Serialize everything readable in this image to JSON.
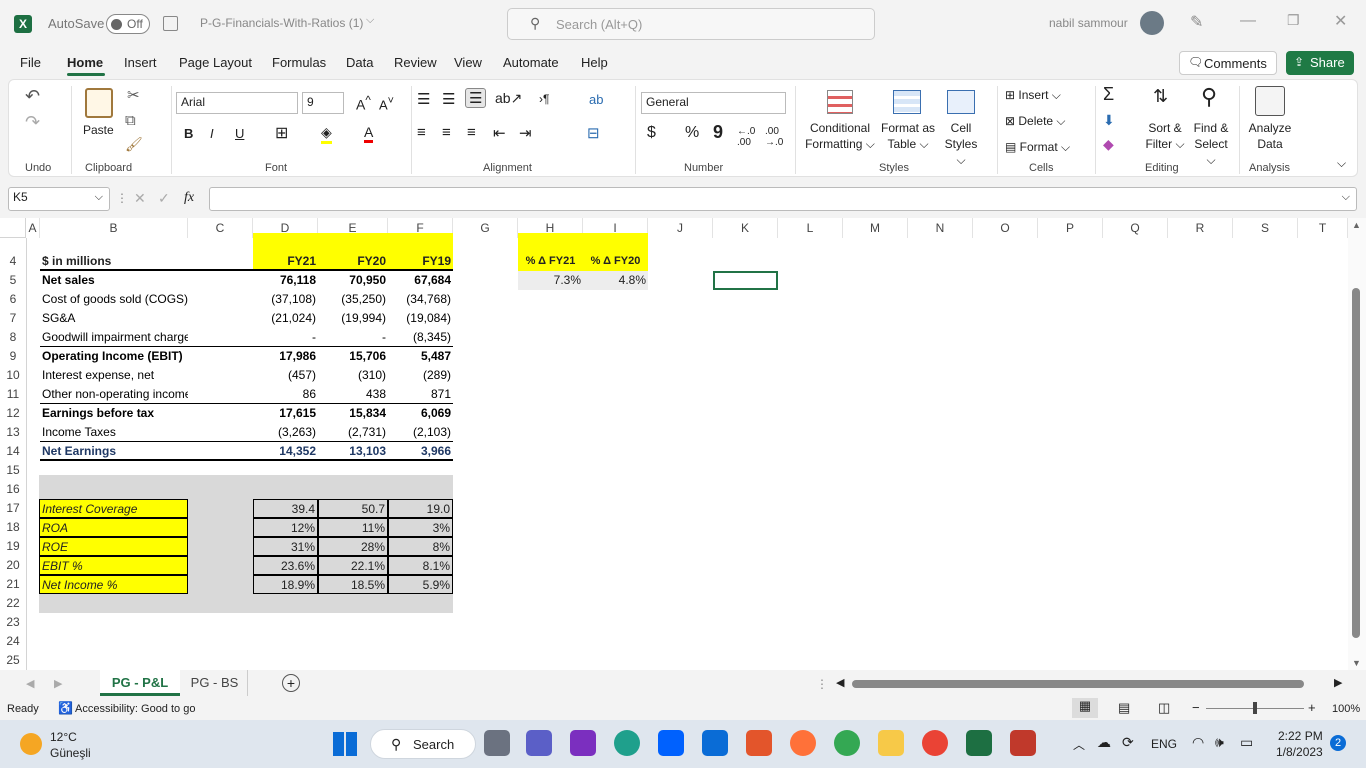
{
  "title": {
    "autosave": "AutoSave",
    "autosave_state": "Off",
    "filename": "P-G-Financials-With-Ratios (1)",
    "search_placeholder": "Search (Alt+Q)",
    "user": "nabil sammour"
  },
  "menu": [
    "File",
    "Home",
    "Insert",
    "Page Layout",
    "Formulas",
    "Data",
    "Review",
    "View",
    "Automate",
    "Help"
  ],
  "menu_right": {
    "comments": "Comments",
    "share": "Share"
  },
  "ribbon": {
    "undo": "Undo",
    "clipboard": "Clipboard",
    "paste": "Paste",
    "font_name": "Arial",
    "font_size": "9",
    "font": "Font",
    "alignment": "Alignment",
    "number_format": "General",
    "number": "Number",
    "cond_fmt_1": "Conditional",
    "cond_fmt_2": "Formatting",
    "fmt_table_1": "Format as",
    "fmt_table_2": "Table",
    "cell_styles_1": "Cell",
    "cell_styles_2": "Styles",
    "styles": "Styles",
    "insert": "Insert",
    "delete": "Delete",
    "format": "Format",
    "cells": "Cells",
    "sort_1": "Sort &",
    "sort_2": "Filter",
    "find_1": "Find &",
    "find_2": "Select",
    "editing": "Editing",
    "analyze_1": "Analyze",
    "analyze_2": "Data",
    "analysis": "Analysis"
  },
  "formula_bar": {
    "name_box": "K5",
    "formula": ""
  },
  "columns": [
    "A",
    "B",
    "C",
    "D",
    "E",
    "F",
    "G",
    "H",
    "I",
    "J",
    "K",
    "L",
    "M",
    "N",
    "O",
    "P",
    "Q",
    "R",
    "S",
    "T"
  ],
  "rows": [
    "4",
    "5",
    "6",
    "7",
    "8",
    "9",
    "10",
    "11",
    "12",
    "13",
    "14",
    "15",
    "16",
    "17",
    "18",
    "19",
    "20",
    "21",
    "22",
    "23",
    "24",
    "25"
  ],
  "sheet": {
    "header": {
      "label": "$ in millions",
      "d": "FY21",
      "e": "FY20",
      "f": "FY19",
      "h": "% Δ FY21",
      "i": "% Δ FY20"
    },
    "lines": [
      {
        "label": "Net sales",
        "d": "76,118",
        "e": "70,950",
        "f": "67,684",
        "bold": true
      },
      {
        "label": "Cost of goods sold (COGS)",
        "d": "(37,108)",
        "e": "(35,250)",
        "f": "(34,768)",
        "bold": false
      },
      {
        "label": "SG&A",
        "d": "(21,024)",
        "e": "(19,994)",
        "f": "(19,084)",
        "bold": false
      },
      {
        "label": "Goodwill impairment charges",
        "d": "-",
        "e": "-",
        "f": "(8,345)",
        "bold": false
      },
      {
        "label": "Operating Income (EBIT)",
        "d": "17,986",
        "e": "15,706",
        "f": "5,487",
        "bold": true
      },
      {
        "label": "Interest expense, net",
        "d": "(457)",
        "e": "(310)",
        "f": "(289)",
        "bold": false
      },
      {
        "label": "Other non-operating income",
        "d": "86",
        "e": "438",
        "f": "871",
        "bold": false
      },
      {
        "label": "Earnings before tax",
        "d": "17,615",
        "e": "15,834",
        "f": "6,069",
        "bold": true
      },
      {
        "label": "Income Taxes",
        "d": "(3,263)",
        "e": "(2,731)",
        "f": "(2,103)",
        "bold": false
      },
      {
        "label": "Net Earnings",
        "d": "14,352",
        "e": "13,103",
        "f": "3,966",
        "bold": true
      }
    ],
    "growth": {
      "h": "7.3%",
      "i": "4.8%"
    },
    "ratios": [
      {
        "label": "Interest Coverage",
        "d": "39.4",
        "e": "50.7",
        "f": "19.0"
      },
      {
        "label": "ROA",
        "d": "12%",
        "e": "11%",
        "f": "3%"
      },
      {
        "label": "ROE",
        "d": "31%",
        "e": "28%",
        "f": "8%"
      },
      {
        "label": "EBIT %",
        "d": "23.6%",
        "e": "22.1%",
        "f": "8.1%"
      },
      {
        "label": "Net Income %",
        "d": "18.9%",
        "e": "18.5%",
        "f": "5.9%"
      }
    ]
  },
  "tabs": [
    "PG - P&L",
    "PG - BS"
  ],
  "status": {
    "ready": "Ready",
    "accessibility": "Accessibility: Good to go",
    "zoom": "100%"
  },
  "taskbar": {
    "temp": "12°C",
    "weather": "Güneşli",
    "search": "Search",
    "lang": "ENG",
    "time": "2:22 PM",
    "date": "1/8/2023",
    "badge": "2"
  }
}
